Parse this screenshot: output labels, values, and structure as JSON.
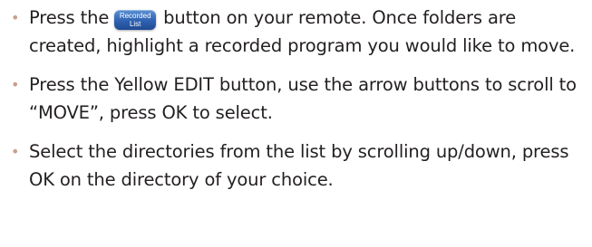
{
  "steps": [
    {
      "before": "Press the",
      "button": {
        "line1": "Recorded",
        "line2": "List",
        "icon": "recorded-list-remote-button"
      },
      "after": "button on your remote. Once folders are created, highlight a recorded program you would like to move."
    },
    {
      "text": "Press the Yellow EDIT button, use the arrow buttons to scroll to “MOVE”, press OK to select."
    },
    {
      "text": "Select the directories from the list by scrolling up/down, press OK on the directory of your choice."
    }
  ],
  "colors": {
    "text": "#231f20",
    "bullet": "#c9a08a",
    "button": "#2f62b0"
  }
}
